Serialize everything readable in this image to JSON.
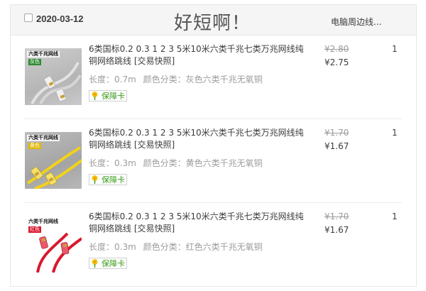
{
  "order": {
    "date": "2020-03-12",
    "shop_name": "好短啊！",
    "header_right": "电脑周边线..."
  },
  "items": [
    {
      "thumb_label": "六类千兆网线",
      "thumb_color": "灰色",
      "title": "6类国标0.2 0.3 1 2 3 5米10米六类千兆七类万兆网线纯铜网络跳线 [交易快照]",
      "length_label": "长度：0.7m",
      "color_label": "颜色分类：灰色六类千兆无氧铜",
      "badge": "保障卡",
      "price_old": "¥2.80",
      "price_new": "¥2.75",
      "qty": "1",
      "cable_color": "#d9d9d9",
      "plug_color": "#e8e8e8",
      "label_bg": "#2e8b2e"
    },
    {
      "thumb_label": "六类千兆网线",
      "thumb_color": "黄色",
      "title": "6类国标0.2 0.3 1 2 3 5米10米六类千兆七类万兆网线纯铜网络跳线 [交易快照]",
      "length_label": "长度：0.3m",
      "color_label": "颜色分类：黄色六类千兆无氧铜",
      "badge": "保障卡",
      "price_old": "¥1.70",
      "price_new": "¥1.67",
      "qty": "1",
      "cable_color": "#f2d21a",
      "plug_color": "#f5e06a",
      "label_bg": "#e0b800"
    },
    {
      "thumb_label": "六类千兆网线",
      "thumb_color": "红色",
      "title": "6类国标0.2 0.3 1 2 3 5米10米六类千兆七类万兆网线纯铜网络跳线 [交易快照]",
      "length_label": "长度：0.3m",
      "color_label": "颜色分类：红色六类千兆无氧铜",
      "badge": "保障卡",
      "price_old": "¥1.70",
      "price_new": "¥1.67",
      "qty": "1",
      "cable_color": "#d9182d",
      "plug_color": "#e85a6a",
      "label_bg": "#d9182d"
    }
  ]
}
